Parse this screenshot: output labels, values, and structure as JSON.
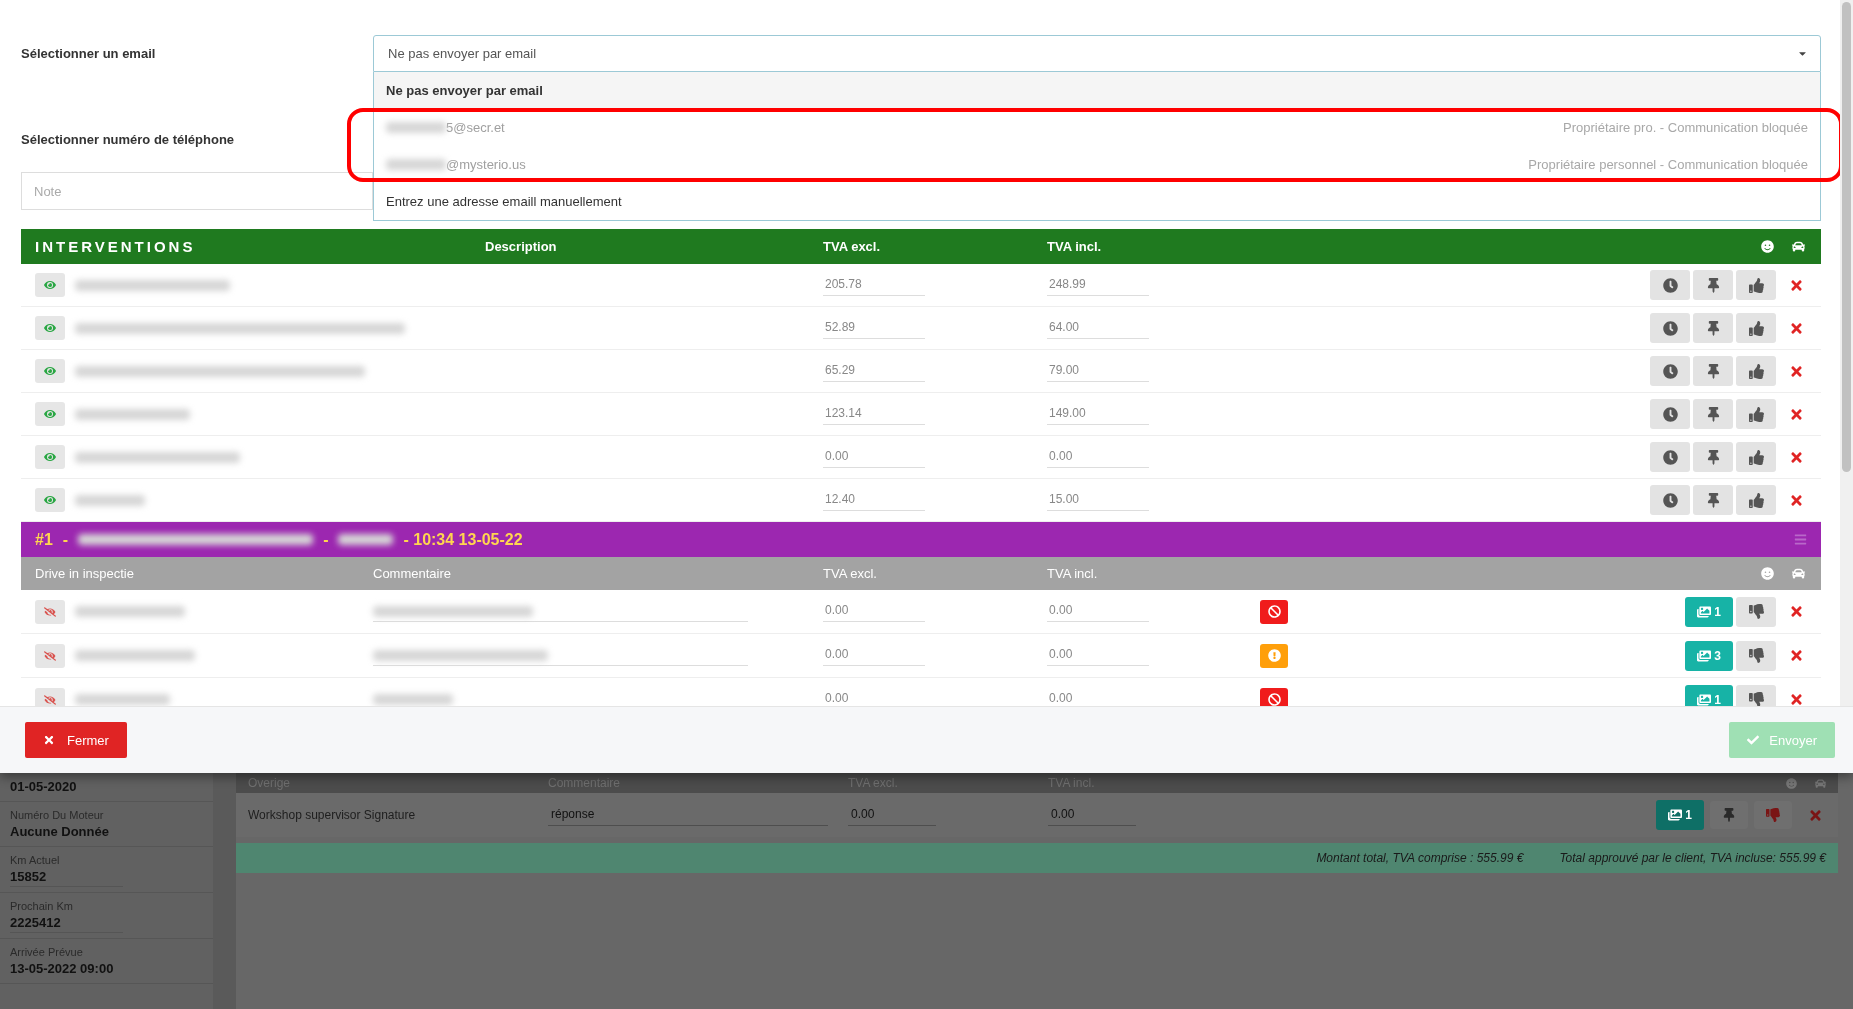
{
  "email_field": {
    "label": "Sélectionner un email",
    "value": "Ne pas envoyer par email",
    "expanded": true,
    "options": [
      {
        "kind": "plain",
        "label": "Ne pas envoyer par email",
        "selected": true,
        "disabled": false
      },
      {
        "kind": "email",
        "label": "5@secr.et",
        "note": "Propriétaire pro. - Communication bloquée",
        "selected": false,
        "disabled": true
      },
      {
        "kind": "email",
        "label": "@mysterio.us",
        "note": "Propriétaire personnel - Communication bloquée",
        "selected": false,
        "disabled": true
      },
      {
        "kind": "plain",
        "label": "Entrez une adresse emaill manuellement",
        "selected": false,
        "disabled": false
      }
    ]
  },
  "phone_field": {
    "label": "Sélectionner numéro de téléphone"
  },
  "note_field": {
    "placeholder": "Note"
  },
  "interventions": {
    "title": "INTERVENTIONS",
    "columns": [
      "Description",
      "TVA excl.",
      "TVA incl."
    ],
    "rows": [
      {
        "visible": true,
        "excl": "205.78",
        "incl": "248.99"
      },
      {
        "visible": true,
        "excl": "52.89",
        "incl": "64.00"
      },
      {
        "visible": true,
        "excl": "65.29",
        "incl": "79.00"
      },
      {
        "visible": true,
        "excl": "123.14",
        "incl": "149.00"
      },
      {
        "visible": true,
        "excl": "0.00",
        "incl": "0.00"
      },
      {
        "visible": true,
        "excl": "12.40",
        "incl": "15.00"
      }
    ]
  },
  "inspection": {
    "number": "#1",
    "separators": [
      "-",
      "-"
    ],
    "time": "- 10:34 13-05-22",
    "columns": [
      "Drive in inspectie",
      "Commentaire",
      "TVA excl.",
      "TVA incl."
    ],
    "rows": [
      {
        "visible": false,
        "excl": "0.00",
        "incl": "0.00",
        "kind": "blocked",
        "photos": "1"
      },
      {
        "visible": false,
        "excl": "0.00",
        "incl": "0.00",
        "kind": "warning",
        "photos": "3"
      },
      {
        "visible": false,
        "excl": "0.00",
        "incl": "0.00",
        "kind": "blocked",
        "photos": "1"
      }
    ]
  },
  "footer": {
    "close": "Fermer",
    "send": {
      "label": "Envoyer",
      "disabled": true
    }
  },
  "background": {
    "sidebar": [
      {
        "value": "01-05-2020"
      },
      {
        "label": "Numéro Du Moteur",
        "value": "Aucune Donnée"
      },
      {
        "label": "Km Actuel",
        "value": "15852",
        "kind": "field"
      },
      {
        "label": "Prochain Km",
        "value": "2225412",
        "kind": "field"
      },
      {
        "label": "Arrivée Prévue",
        "value": "13-05-2022 09:00"
      }
    ],
    "columns": [
      "Overige",
      "Commentaire",
      "TVA excl.",
      "TVA incl."
    ],
    "row": {
      "description": "Workshop supervisor Signature",
      "comment": "réponse",
      "excl": "0.00",
      "incl": "0.00",
      "photos": "1"
    },
    "totals": [
      "Montant total, TVA comprise : 555.99 €",
      "Total approuvé par le client, TVA incluse: 555.99 €"
    ]
  }
}
